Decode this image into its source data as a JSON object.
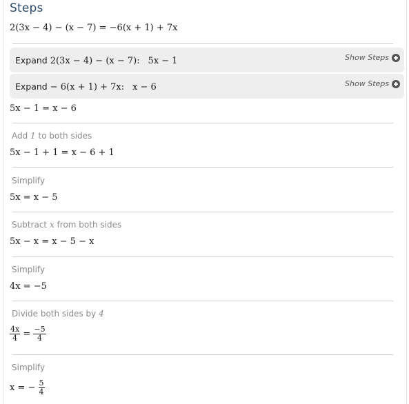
{
  "title": "Steps",
  "equation": "2(3x − 4) − (x − 7) = −6(x + 1) + 7x",
  "expand_boxes": [
    {
      "label": "Expand",
      "expr": "2(3x − 4) − (x − 7):",
      "result": "5x − 1",
      "show_steps": "Show Steps"
    },
    {
      "label": "Expand",
      "expr": "− 6(x + 1) + 7x:",
      "result": "x − 6",
      "show_steps": "Show Steps"
    }
  ],
  "expanded": "5x − 1 = x − 6",
  "steps": [
    {
      "label_pre": "Add ",
      "label_math": "1",
      "label_post": " to both sides",
      "result": "5x − 1 + 1 = x − 6 + 1"
    },
    {
      "label_pre": "Simplify",
      "label_math": "",
      "label_post": "",
      "result": "5x = x − 5"
    },
    {
      "label_pre": "Subtract ",
      "label_math": "x",
      "label_post": " from both sides",
      "result": "5x − x = x − 5 − x"
    },
    {
      "label_pre": "Simplify",
      "label_math": "",
      "label_post": "",
      "result": "4x = −5"
    },
    {
      "label_pre": "Divide both sides by ",
      "label_math": "4",
      "label_post": "",
      "result_frac": {
        "lhs_num": "4x",
        "lhs_den": "4",
        "eq": "=",
        "rhs_num": "−5",
        "rhs_den": "4"
      }
    },
    {
      "label_pre": "Simplify",
      "label_math": "",
      "label_post": "",
      "result_final": {
        "lhs": "x = −",
        "num": "5",
        "den": "4"
      }
    }
  ]
}
